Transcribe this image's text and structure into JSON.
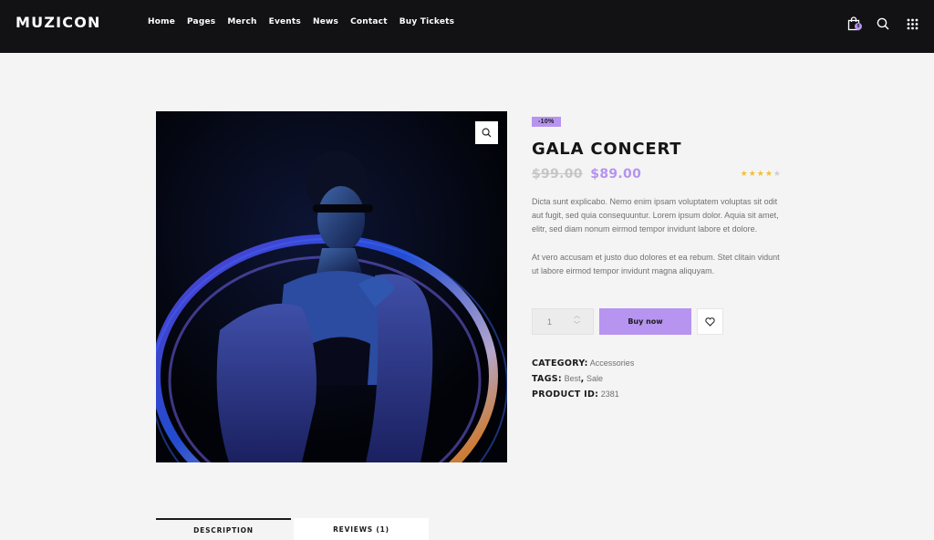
{
  "brand": {
    "logo": "MUZICON"
  },
  "nav": {
    "items": [
      {
        "label": "Home"
      },
      {
        "label": "Pages"
      },
      {
        "label": "Merch"
      },
      {
        "label": "Events"
      },
      {
        "label": "News"
      },
      {
        "label": "Contact"
      },
      {
        "label": "Buy Tickets"
      }
    ]
  },
  "header_icons": {
    "cart_count": "0",
    "cart": "shopping-bag-icon",
    "search": "search-icon",
    "menu": "grid-menu-icon"
  },
  "product": {
    "badge": "-10%",
    "title": "GALA CONCERT",
    "old_price": "$99.00",
    "new_price": "$89.00",
    "rating": 4,
    "rating_max": 5,
    "description_1": "Dicta sunt explicabo. Nemo enim ipsam voluptatem voluptas sit odit aut fugit, sed quia consequuntur. Lorem ipsum dolor. Aquia sit amet, elitr, sed diam nonum eirmod tempor invidunt labore et dolore.",
    "description_2": "At vero accusam et justo duo dolores et ea rebum. Stet clitain vidunt ut labore eirmod tempor invidunt magna aliquyam.",
    "quantity": "1",
    "buy_label": "Buy now",
    "category_label": "CATEGORY:",
    "category_value": "Accessories",
    "tags_label": "TAGS:",
    "tags": [
      "Best",
      "Sale"
    ],
    "tag_separator": ",",
    "id_label": "PRODUCT ID:",
    "id_value": "2381"
  },
  "tabs": [
    {
      "label": "DESCRIPTION"
    },
    {
      "label": "REVIEWS (1)"
    }
  ],
  "colors": {
    "accent": "#b694f0",
    "header_bg": "#121214",
    "page_bg": "#f4f4f4",
    "star": "#f3c033"
  }
}
